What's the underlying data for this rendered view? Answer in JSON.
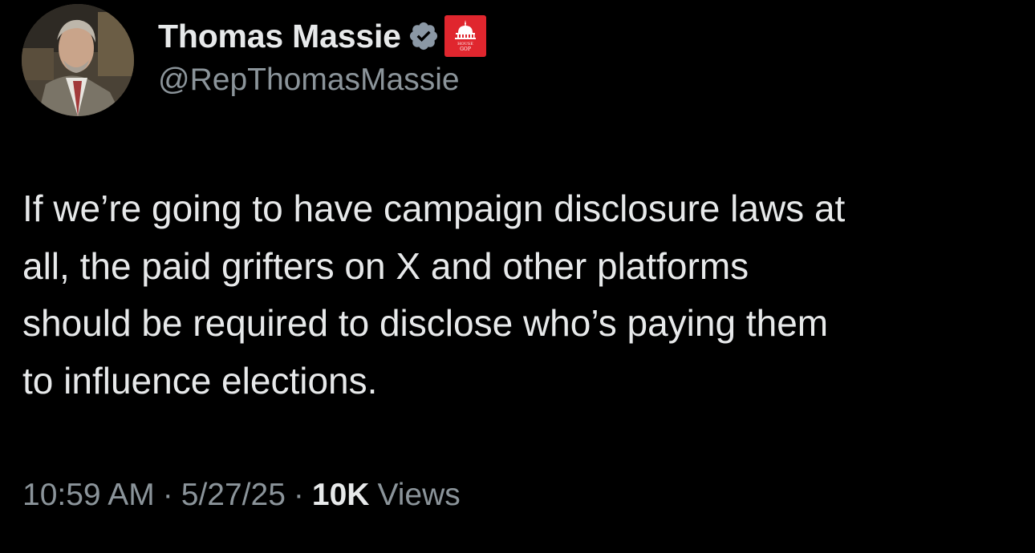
{
  "author": {
    "display_name": "Thomas Massie",
    "handle": "@RepThomasMassie",
    "verified_icon": "verified-badge-icon",
    "affiliation_icon": "house-gop-badge-icon",
    "affiliation_badge_text_1": "HOUSE",
    "affiliation_badge_text_2": "GOP",
    "verified_color": "#8b98a5",
    "affiliation_color": "#e0262e"
  },
  "tweet": {
    "text": "If we’re going to have campaign disclosure laws at\nall, the paid grifters on X and other platforms\nshould be required to disclose who’s paying them\nto influence elections."
  },
  "meta": {
    "time": "10:59 AM",
    "separator": "·",
    "date": "5/27/25",
    "views_count": "10K",
    "views_label": "Views"
  },
  "theme": {
    "background": "#000000",
    "primary_text": "#e7e9ea",
    "secondary_text": "#8b949a"
  }
}
